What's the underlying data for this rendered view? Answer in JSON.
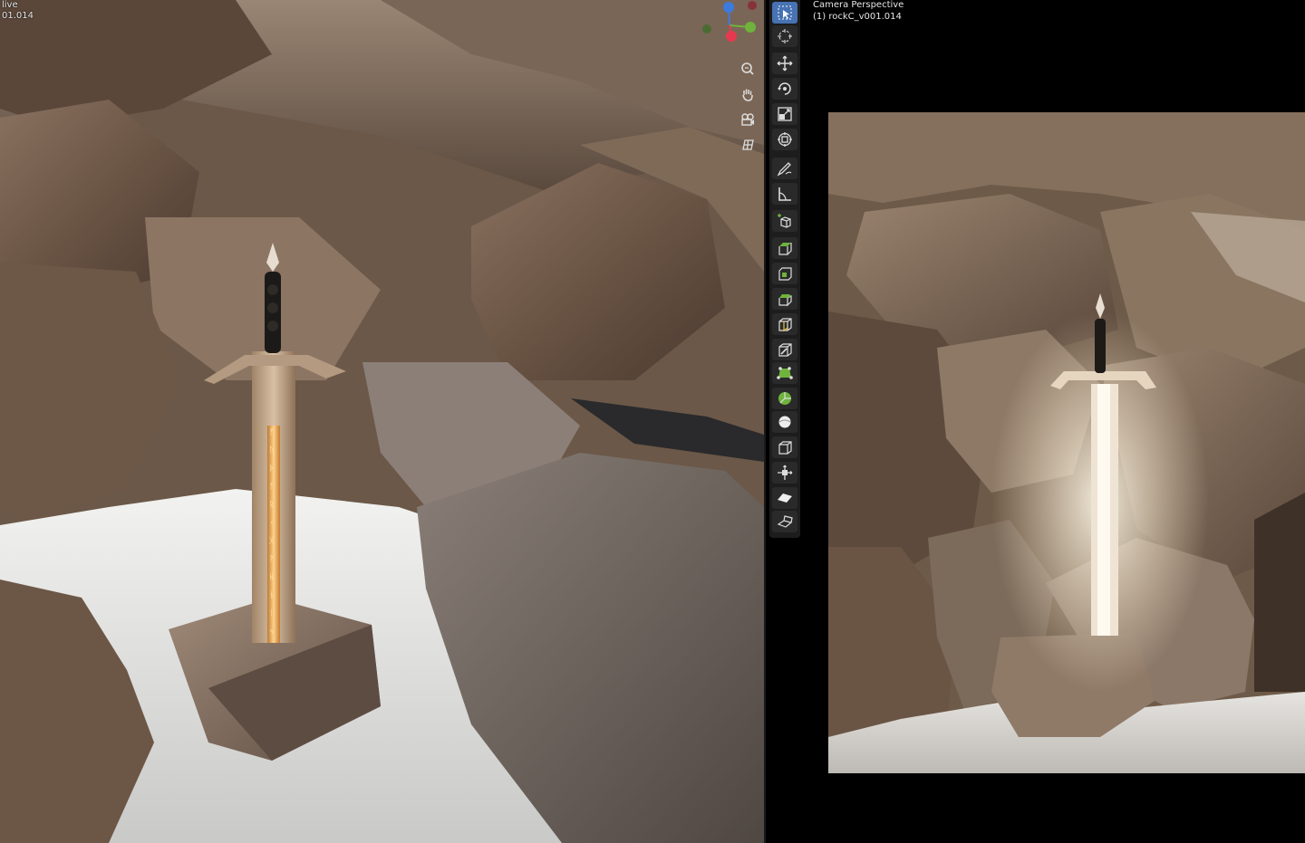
{
  "viewport_left": {
    "mode_label": "live",
    "object_label": "01.014"
  },
  "viewport_right": {
    "view_name": "Camera Perspective",
    "object_name": "(1) rockC_v001.014"
  },
  "gizmo": {
    "axis_x_color": "#e63950",
    "axis_y_color": "#6fb33d",
    "axis_z_color": "#3d7adf"
  },
  "navigation": [
    "zoom-icon",
    "hand-pan-icon",
    "camera-icon",
    "grid-ortho-icon"
  ],
  "toolbar": {
    "active_tool": "select-box",
    "accent": "#4772b3",
    "tools": [
      "select-box-icon",
      "cursor-icon",
      "move-icon",
      "rotate-icon",
      "scale-icon",
      "transform-icon",
      "annotate-icon",
      "measure-icon",
      "add-cube-icon",
      "extrude-region-icon",
      "inset-faces-icon",
      "bevel-icon",
      "loop-cut-icon",
      "knife-icon",
      "poly-build-icon",
      "spin-icon",
      "smooth-icon",
      "edge-slide-icon",
      "shrink-fatten-icon",
      "shear-icon",
      "rip-region-icon"
    ]
  },
  "scene": {
    "rune_glow_color": "#ffb25a",
    "snow_color": "#e8e8e6",
    "rock_color": "#7d6450"
  }
}
